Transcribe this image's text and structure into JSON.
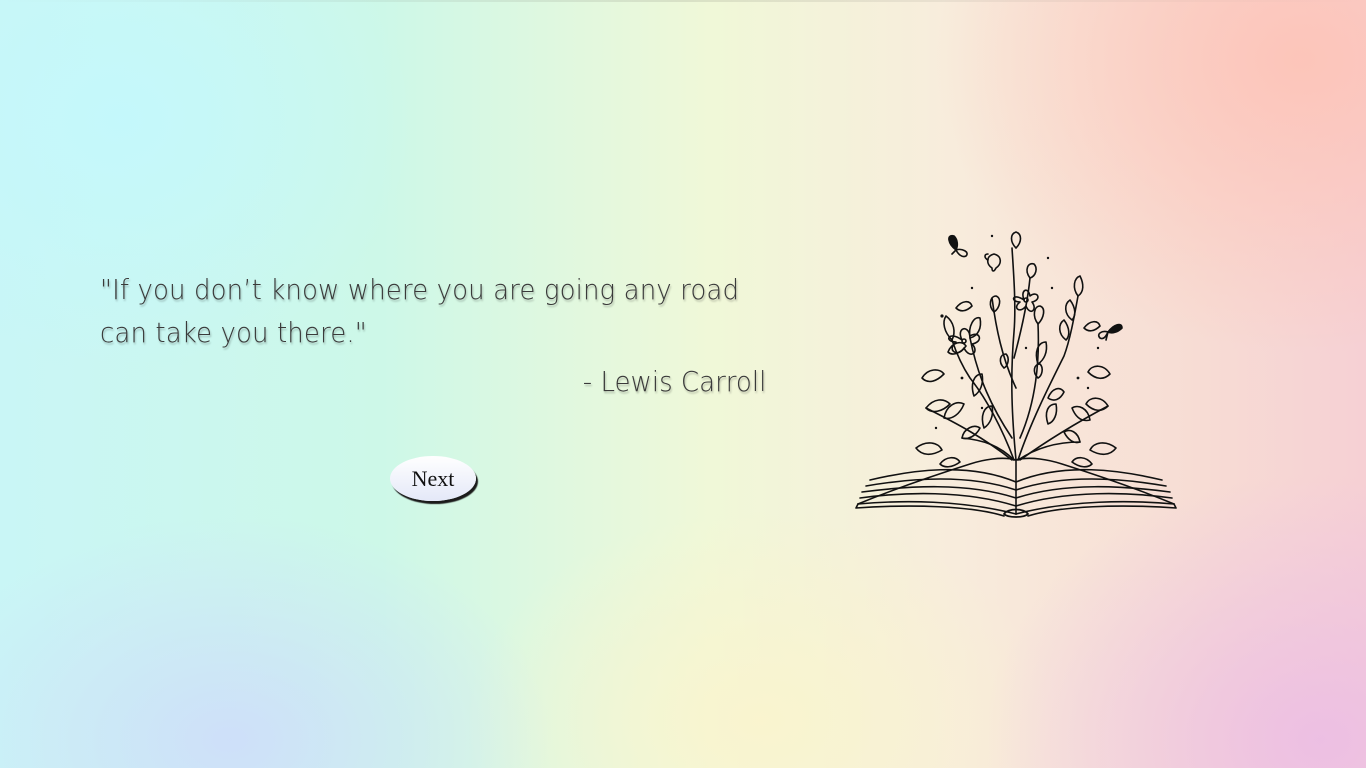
{
  "quote": {
    "text": "\"If you don’t know where you are going any road can take you there.\"",
    "author": "- Lewis Carroll"
  },
  "controls": {
    "next_label": "Next"
  },
  "illustration": {
    "icon": "open-book-with-flowers-icon"
  },
  "colors": {
    "text": "#3a3a3a",
    "button_fill": "#eef0fa",
    "button_shadow": "#1b1b1b"
  }
}
